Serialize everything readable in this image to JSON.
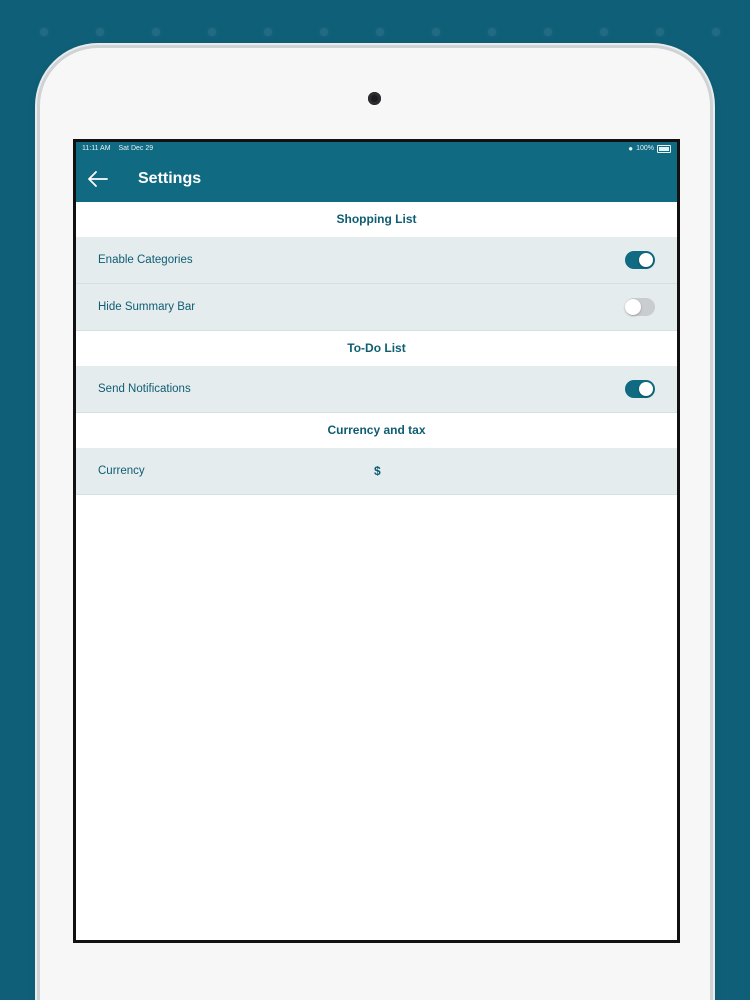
{
  "status_bar": {
    "time": "11:11 AM",
    "date": "Sat Dec 29",
    "battery": "100%"
  },
  "app_bar": {
    "title": "Settings",
    "back_icon": "arrow-left-icon"
  },
  "sections": {
    "shopping": {
      "header": "Shopping List",
      "enable_categories": {
        "label": "Enable Categories",
        "on": true
      },
      "hide_summary_bar": {
        "label": "Hide Summary Bar",
        "on": false
      }
    },
    "todo": {
      "header": "To-Do List",
      "send_notifications": {
        "label": "Send Notifications",
        "on": true
      }
    },
    "currency": {
      "header": "Currency and tax",
      "currency_row": {
        "label": "Currency",
        "value": "$"
      }
    }
  },
  "colors": {
    "background": "#0f5f78",
    "accent": "#0f6a82",
    "row_background": "#e5ecee",
    "text": "#0e5d72"
  }
}
